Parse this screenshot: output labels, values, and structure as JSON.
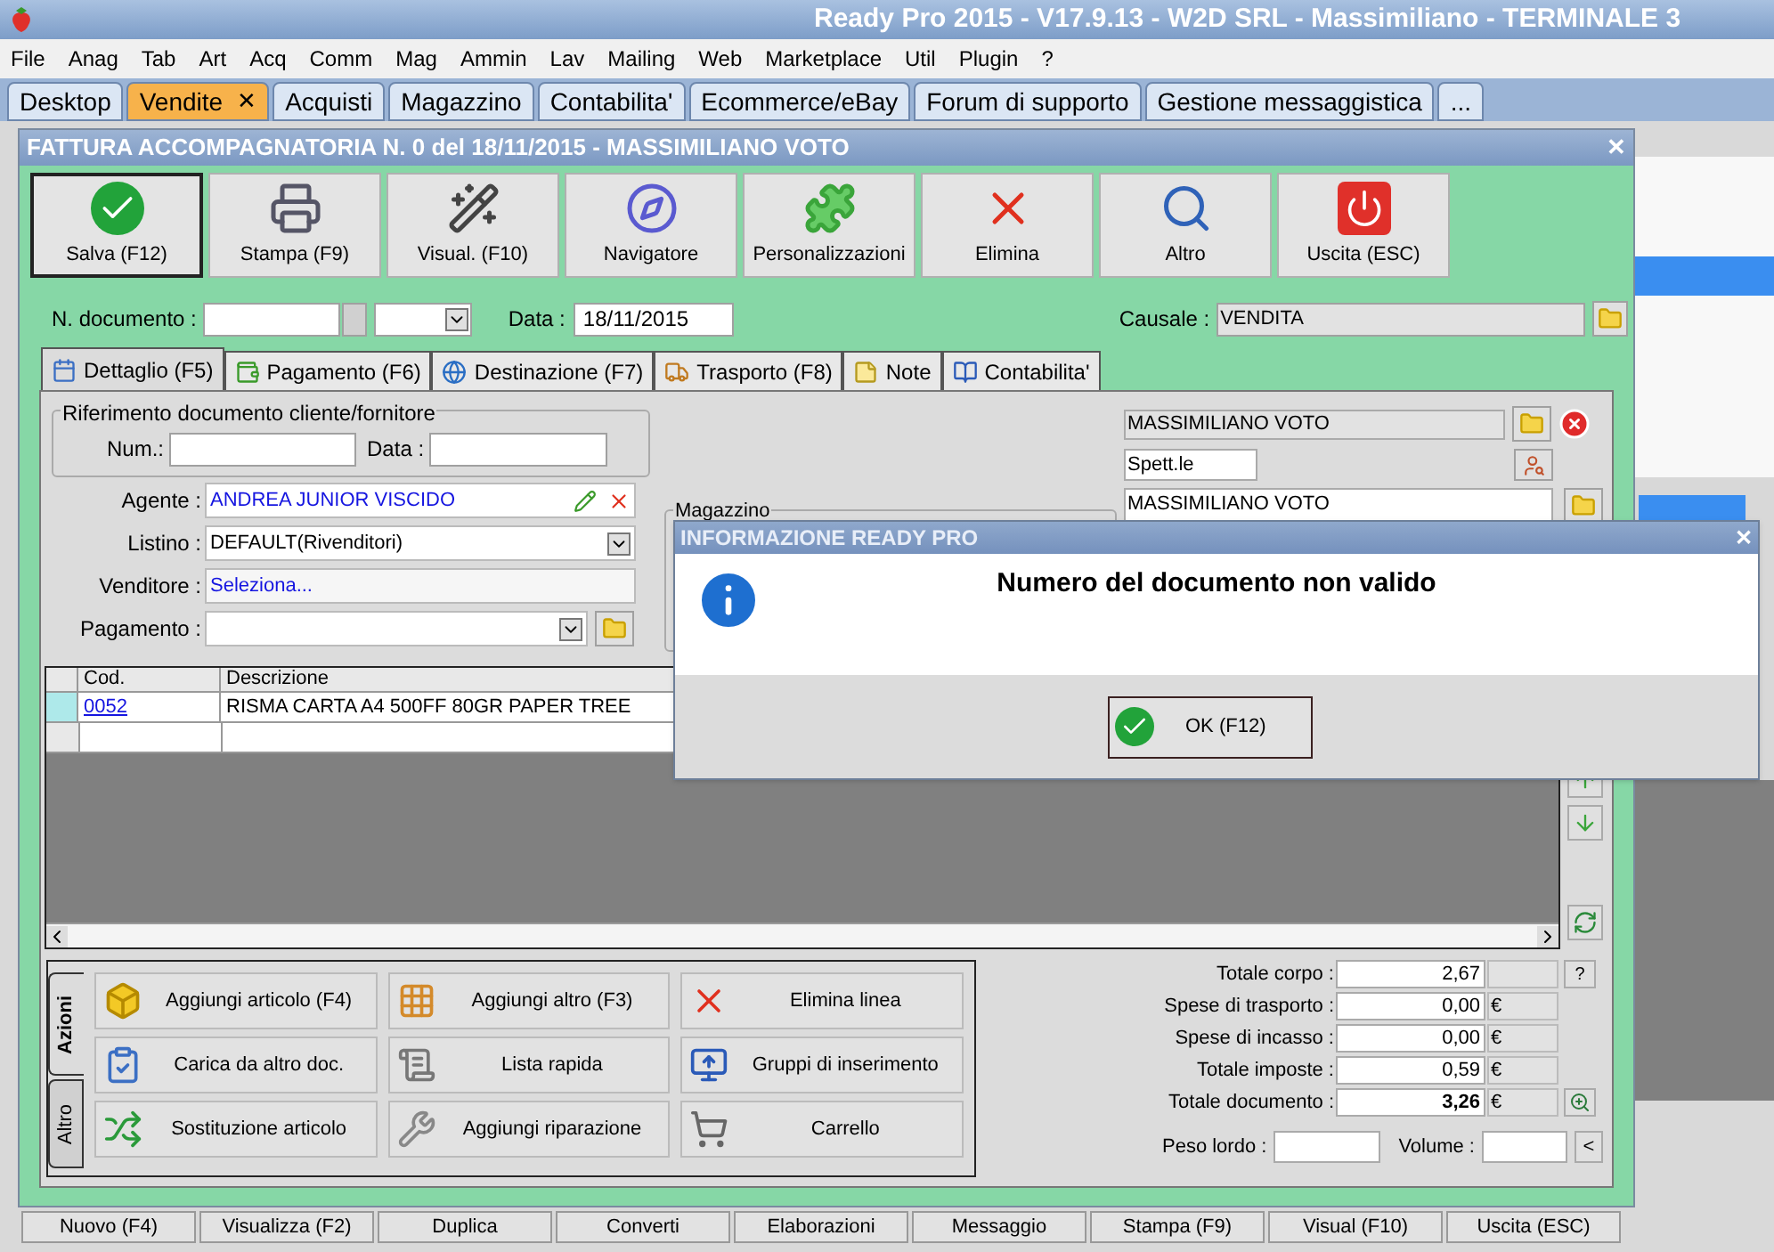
{
  "app": {
    "title": "Ready Pro 2015 - V17.9.13 - W2D SRL - Massimiliano - TERMINALE 3"
  },
  "menu": [
    "File",
    "Anag",
    "Tab",
    "Art",
    "Acq",
    "Comm",
    "Mag",
    "Ammin",
    "Lav",
    "Mailing",
    "Web",
    "Marketplace",
    "Util",
    "Plugin",
    "?"
  ],
  "module_tabs": [
    {
      "label": "Desktop",
      "selected": false
    },
    {
      "label": "Vendite",
      "selected": true,
      "close": "✕"
    },
    {
      "label": "Acquisti",
      "selected": false
    },
    {
      "label": "Magazzino",
      "selected": false
    },
    {
      "label": "Contabilita'",
      "selected": false
    },
    {
      "label": "Ecommerce/eBay",
      "selected": false
    },
    {
      "label": "Forum di supporto",
      "selected": false
    },
    {
      "label": "Gestione messaggistica",
      "selected": false
    },
    {
      "label": "...",
      "selected": false
    }
  ],
  "document_window": {
    "title": "FATTURA ACCOMPAGNATORIA N. 0 del 18/11/2015 - MASSIMILIANO VOTO",
    "close": "✕",
    "toolbar": [
      {
        "label": "Salva (F12)",
        "kind": "check",
        "selected": true
      },
      {
        "label": "Stampa (F9)",
        "kind": "printer",
        "selected": false
      },
      {
        "label": "Visual. (F10)",
        "kind": "wand",
        "selected": false
      },
      {
        "label": "Navigatore",
        "kind": "compass",
        "selected": false
      },
      {
        "label": "Personalizzazioni",
        "kind": "puzzle",
        "selected": false
      },
      {
        "label": "Elimina",
        "kind": "cross",
        "selected": false
      },
      {
        "label": "Altro",
        "kind": "magnifier",
        "selected": false
      },
      {
        "label": "Uscita (ESC)",
        "kind": "power",
        "selected": false
      }
    ],
    "header": {
      "number_label": "N. documento :",
      "date_label": "Data :",
      "date": "18/11/2015",
      "causale_label": "Causale :",
      "causale": "VENDITA"
    },
    "tabs": [
      {
        "label": "Dettaglio (F5)",
        "kind": "calendar",
        "selected": true
      },
      {
        "label": "Pagamento (F6)",
        "kind": "wallet",
        "selected": false
      },
      {
        "label": "Destinazione (F7)",
        "kind": "globe",
        "selected": false
      },
      {
        "label": "Trasporto (F8)",
        "kind": "truck",
        "selected": false
      },
      {
        "label": "Note",
        "kind": "note",
        "selected": false
      },
      {
        "label": "Contabilita'",
        "kind": "book",
        "selected": false
      }
    ],
    "reference": {
      "title": "Riferimento documento cliente/fornitore",
      "num_label": "Num.:",
      "date_label": "Data :"
    },
    "fields": [
      {
        "label": "Agente :",
        "value": "ANDREA JUNIOR VISCIDO",
        "kind": "agent"
      },
      {
        "label": "Listino :",
        "value": "DEFAULT(Rivenditori)",
        "kind": "select"
      },
      {
        "label": "Venditore :",
        "value": "Seleziona...",
        "kind": "link"
      },
      {
        "label": "Pagamento :",
        "kind": "select_folder"
      }
    ],
    "warehouse_label": "Magazzino",
    "customer": {
      "name": "MASSIMILIANO VOTO",
      "salutation": "Spett.le",
      "address": "MASSIMILIANO VOTO"
    },
    "grid": {
      "columns": [
        "Cod.",
        "Descrizione"
      ],
      "rows": [
        {
          "code": "0052",
          "description": "RISMA CARTA A4 500FF 80GR PAPER TREE",
          "selected": true
        }
      ]
    },
    "action_tabs": [
      {
        "label": "Azioni",
        "selected": true
      },
      {
        "label": "Altro",
        "selected": false
      }
    ],
    "actions": [
      {
        "label": "Aggiungi articolo (F4)",
        "kind": "box"
      },
      {
        "label": "Aggiungi altro (F3)",
        "kind": "grid"
      },
      {
        "label": "Elimina linea",
        "kind": "cross"
      },
      {
        "label": "Carica da altro doc.",
        "kind": "gridcheck"
      },
      {
        "label": "Lista rapida",
        "kind": "scroll"
      },
      {
        "label": "Gruppi di inserimento",
        "kind": "groups"
      },
      {
        "label": "Sostituzione articolo",
        "kind": "swap"
      },
      {
        "label": "Aggiungi riparazione",
        "kind": "wrench"
      },
      {
        "label": "Carrello",
        "kind": "cart"
      }
    ],
    "totals": [
      {
        "label": "Totale corpo :",
        "value": "2,67",
        "kind": "help",
        "button": "?"
      },
      {
        "label": "Spese di trasporto :",
        "value": "0,00",
        "unit": "€",
        "kind": "plain"
      },
      {
        "label": "Spese di incasso :",
        "value": "0,00",
        "unit": "€",
        "kind": "plain"
      },
      {
        "label": "Totale imposte :",
        "value": "0,59",
        "unit": "€",
        "kind": "plain"
      },
      {
        "label": "Totale documento :",
        "value": "3,26",
        "unit": "€",
        "kind": "total"
      }
    ],
    "weight": {
      "gross_label": "Peso lordo :",
      "volume_label": "Volume :",
      "button": "<"
    }
  },
  "bottom_buttons": [
    "Nuovo (F4)",
    "Visualizza (F2)",
    "Duplica",
    "Converti",
    "Elaborazioni",
    "Messaggio",
    "Stampa (F9)",
    "Visual (F10)",
    "Uscita (ESC)"
  ],
  "dialog": {
    "title": "INFORMAZIONE READY PRO",
    "close": "✕",
    "message": "Numero del documento non valido",
    "button": "OK (F12)"
  }
}
